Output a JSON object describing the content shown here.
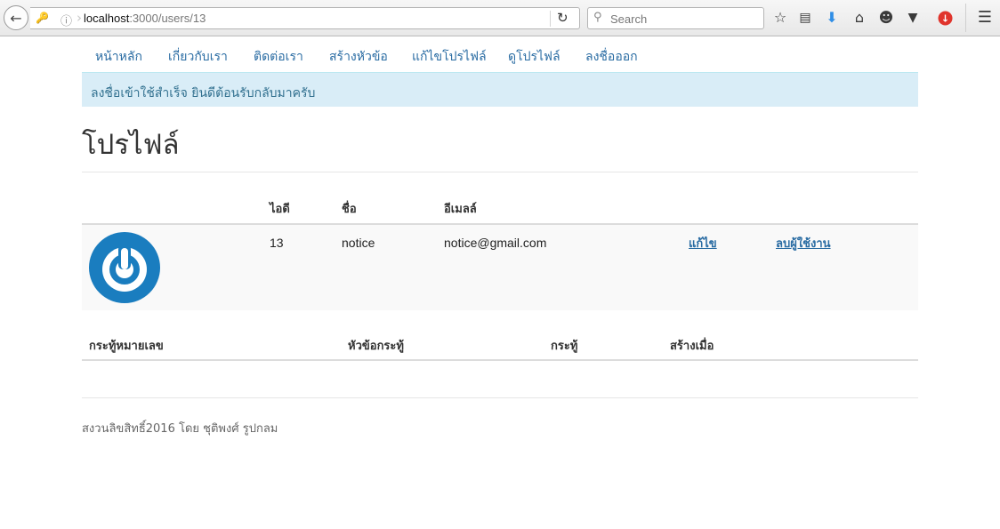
{
  "browser": {
    "url_host": "localhost",
    "url_rest": ":3000/users/13",
    "search_placeholder": "Search"
  },
  "nav": {
    "items": [
      "หน้าหลัก",
      "เกี่ยวกับเรา",
      "ติดต่อเรา",
      "สร้างหัวข้อ",
      "แก้ไขโปรไฟล์",
      "ดูโปรไฟล์",
      "ลงชื่อออก"
    ]
  },
  "alert": {
    "message": "ลงชื่อเข้าใช้สำเร็จ ยินดีต้อนรับกลับมาครับ"
  },
  "page": {
    "title": "โปรไฟล์"
  },
  "user_table": {
    "headers": {
      "id": "ไอดี",
      "name": "ชื่อ",
      "email": "อีเมลล์"
    },
    "row": {
      "id": "13",
      "name": "notice",
      "email": "notice@gmail.com",
      "edit_label": "แก้ไข",
      "delete_label": "ลบผู้ใช้งาน"
    }
  },
  "post_table": {
    "headers": {
      "number": "กระทู้หมายเลข",
      "topic": "หัวข้อกระทู้",
      "post": "กระทู้",
      "created": "สร้างเมื่อ"
    }
  },
  "footer": {
    "text": "สงวนลิขสิทธิ์2016 โดย ชุติพงศ์ รูปกลม"
  },
  "colors": {
    "link": "#2a6ca3",
    "alert_bg": "#d9edf7",
    "alert_text": "#31708f",
    "avatar": "#1a7dbf"
  }
}
